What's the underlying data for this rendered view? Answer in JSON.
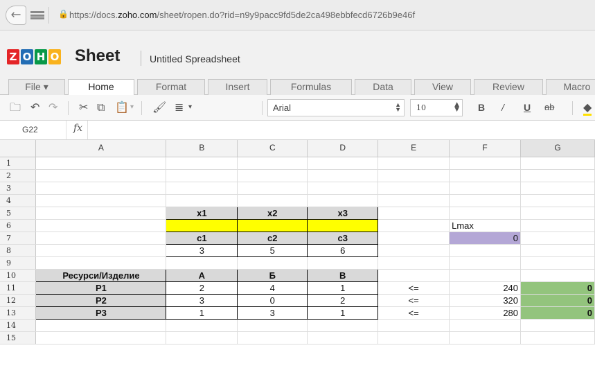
{
  "browser": {
    "url_prefix": "https://docs.",
    "url_domain": "zoho.com",
    "url_path": "/sheet/ropen.do?rid=n9y9pacc9fd5de2ca498ebbfecd6726b9e46f"
  },
  "app": {
    "logo_letters": [
      "Z",
      "O",
      "H",
      "O"
    ],
    "logo_colors": [
      "#e42527",
      "#226db4",
      "#089949",
      "#f9b21d"
    ],
    "product": "Sheet",
    "doc_title": "Untitled Spreadsheet"
  },
  "tabs": [
    "File ▾",
    "Home",
    "Format",
    "Insert",
    "Formulas",
    "Data",
    "View",
    "Review",
    "Macro"
  ],
  "toolbar": {
    "font": "Arial",
    "size": "10",
    "bold": "B",
    "italic": "/",
    "underline": "U",
    "strike": "ab"
  },
  "formula_bar": {
    "cell_ref": "G22",
    "fx": "fx",
    "formula": ""
  },
  "columns": [
    "A",
    "B",
    "C",
    "D",
    "E",
    "F",
    "G"
  ],
  "rows": [
    "1",
    "2",
    "3",
    "4",
    "5",
    "6",
    "7",
    "8",
    "9",
    "10",
    "11",
    "12",
    "13",
    "14",
    "15"
  ],
  "cells": {
    "r5": {
      "B": "x1",
      "C": "x2",
      "D": "x3"
    },
    "r6": {
      "F": "Lmax"
    },
    "r7": {
      "B": "c1",
      "C": "c2",
      "D": "c3",
      "F": "0"
    },
    "r8": {
      "B": "3",
      "C": "5",
      "D": "6"
    },
    "r10": {
      "A": "Ресурси/Изделие",
      "B": "А",
      "C": "Б",
      "D": "В"
    },
    "r11": {
      "A": "P1",
      "B": "2",
      "C": "4",
      "D": "1",
      "E": "<=",
      "F": "240",
      "G": "0"
    },
    "r12": {
      "A": "P2",
      "B": "3",
      "C": "0",
      "D": "2",
      "E": "<=",
      "F": "320",
      "G": "0"
    },
    "r13": {
      "A": "P3",
      "B": "1",
      "C": "3",
      "D": "1",
      "E": "<=",
      "F": "280",
      "G": "0"
    }
  },
  "colors": {
    "header_gray": "#d9d9d9",
    "input_yellow": "#ffff00",
    "objective_purple": "#b4a7d6",
    "constraint_green": "#93c47d"
  }
}
